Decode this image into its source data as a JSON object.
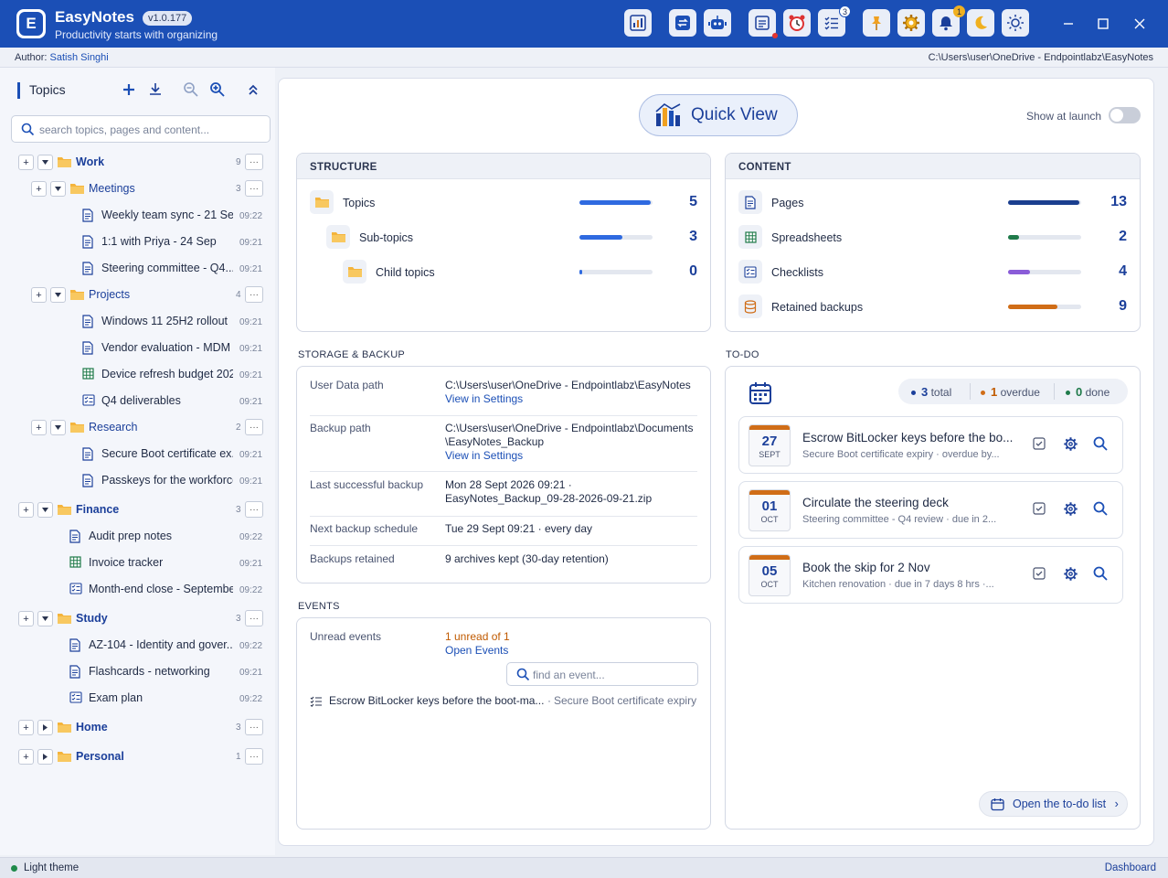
{
  "app": {
    "logo_letter": "E",
    "name": "EasyNotes",
    "version": "v1.0.177",
    "tagline": "Productivity starts with organizing"
  },
  "toolbar": {
    "tasks_badge": "3",
    "notifications_badge": "1"
  },
  "author": {
    "label": "Author:",
    "name": "Satish Singhi",
    "path": "C:\\Users\\user\\OneDrive - Endpointlabz\\EasyNotes"
  },
  "sidebar": {
    "title": "Topics",
    "search_placeholder": "search topics, pages and content...",
    "tree": [
      {
        "label": "Work",
        "count": "9"
      },
      {
        "label": "Meetings",
        "count": "3"
      },
      {
        "label": "Weekly team sync - 21 Sep",
        "time": "09:22"
      },
      {
        "label": "1:1 with Priya - 24 Sep",
        "time": "09:21"
      },
      {
        "label": "Steering committee - Q4...",
        "time": "09:21"
      },
      {
        "label": "Projects",
        "count": "4"
      },
      {
        "label": "Windows 11 25H2 rollout",
        "time": "09:21"
      },
      {
        "label": "Vendor evaluation - MDM",
        "time": "09:21"
      },
      {
        "label": "Device refresh budget 2026",
        "time": "09:21"
      },
      {
        "label": "Q4 deliverables",
        "time": "09:21"
      },
      {
        "label": "Research",
        "count": "2"
      },
      {
        "label": "Secure Boot certificate ex...",
        "time": "09:21"
      },
      {
        "label": "Passkeys for the workforce",
        "time": "09:21"
      },
      {
        "label": "Finance",
        "count": "3"
      },
      {
        "label": "Audit prep notes",
        "time": "09:22"
      },
      {
        "label": "Invoice tracker",
        "time": "09:21"
      },
      {
        "label": "Month-end close - September",
        "time": "09:22"
      },
      {
        "label": "Study",
        "count": "3"
      },
      {
        "label": "AZ-104 - Identity and gover...",
        "time": "09:22"
      },
      {
        "label": "Flashcards - networking",
        "time": "09:21"
      },
      {
        "label": "Exam plan",
        "time": "09:22"
      },
      {
        "label": "Home",
        "count": "3"
      },
      {
        "label": "Personal",
        "count": "1"
      }
    ],
    "button_add": "+",
    "button_more": "···"
  },
  "quickview": {
    "label": "Quick View",
    "show_at_launch": "Show at launch",
    "show_at_launch_on": false
  },
  "structure": {
    "title": "STRUCTURE",
    "rows": [
      {
        "label": "Topics",
        "value": "5",
        "fill": 1.0
      },
      {
        "label": "Sub-topics",
        "value": "3",
        "fill": 0.6
      },
      {
        "label": "Child topics",
        "value": "0",
        "fill": 0.03
      }
    ]
  },
  "content": {
    "title": "CONTENT",
    "rows": [
      {
        "label": "Pages",
        "value": "13",
        "fill": 1.0,
        "color": "#1b3f8f"
      },
      {
        "label": "Spreadsheets",
        "value": "2",
        "fill": 0.15,
        "color": "#1f7a4a"
      },
      {
        "label": "Checklists",
        "value": "4",
        "fill": 0.31,
        "color": "#8a5cd8"
      },
      {
        "label": "Retained backups",
        "value": "9",
        "fill": 0.69,
        "color": "#d06d17"
      }
    ]
  },
  "storage": {
    "title": "STORAGE & BACKUP",
    "rows": [
      {
        "key": "User Data path",
        "value": "C:\\Users\\user\\OneDrive - Endpointlabz\\EasyNotes",
        "link": "View in Settings"
      },
      {
        "key": "Backup path",
        "value": "C:\\Users\\user\\OneDrive - Endpointlabz\\Documents",
        "value2": "\\EasyNotes_Backup",
        "link": "View in Settings"
      },
      {
        "key": "Last successful backup",
        "value": "Mon 28 Sept 2026 09:21  ·",
        "value2": "EasyNotes_Backup_09-28-2026-09-21.zip"
      },
      {
        "key": "Next backup schedule",
        "value": "Tue 29 Sept 09:21  ·  every day"
      },
      {
        "key": "Backups retained",
        "value": "9 archives kept (30-day retention)"
      }
    ]
  },
  "events": {
    "title": "EVENTS",
    "unread_label": "Unread events",
    "unread_value": "1 unread of 1",
    "open_link": "Open Events",
    "search_placeholder": "find an event...",
    "item": {
      "title": "Escrow BitLocker keys before the boot-ma...",
      "topic": "Secure Boot certificate expiry"
    }
  },
  "todo": {
    "title": "TO-DO",
    "total": "3",
    "total_label": "total",
    "overdue": "1",
    "overdue_label": "overdue",
    "done": "0",
    "done_label": "done",
    "items": [
      {
        "day": "27",
        "month": "SEPT",
        "title": "Escrow BitLocker keys before the bo...",
        "sub": "Secure Boot certificate expiry  ·  overdue by..."
      },
      {
        "day": "01",
        "month": "OCT",
        "title": "Circulate the steering deck",
        "sub": "Steering committee - Q4 review  ·  due in 2..."
      },
      {
        "day": "05",
        "month": "OCT",
        "title": "Book the skip for 2 Nov",
        "sub": "Kitchen renovation  ·  due in 7 days 8 hrs  ·..."
      }
    ],
    "open_button": "Open the to-do list",
    "chevron": "›"
  },
  "status": {
    "theme": "Light theme",
    "view": "Dashboard"
  }
}
